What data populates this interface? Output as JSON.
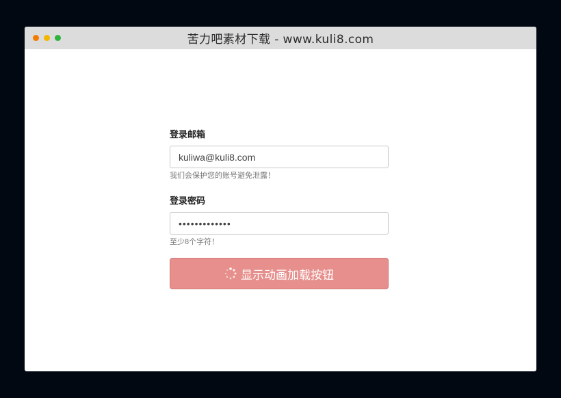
{
  "window": {
    "title": "苦力吧素材下载 - www.kuli8.com"
  },
  "form": {
    "email": {
      "label": "登录邮箱",
      "value": "kuliwa@kuli8.com",
      "help": "我们会保护您的账号避免泄露！"
    },
    "password": {
      "label": "登录密码",
      "value": "•••••••••••••",
      "help": "至少8个字符！"
    },
    "submit": {
      "label": "显示动画加载按钮",
      "state": "loading"
    }
  },
  "colors": {
    "page_background": "#020812",
    "titlebar": "#dcdcdc",
    "button": "#e68f8c",
    "dot_close": "#f47b00",
    "dot_minimize": "#f3b700",
    "dot_maximize": "#2db43f"
  },
  "icons": {
    "button_icon": "spinner-icon"
  }
}
